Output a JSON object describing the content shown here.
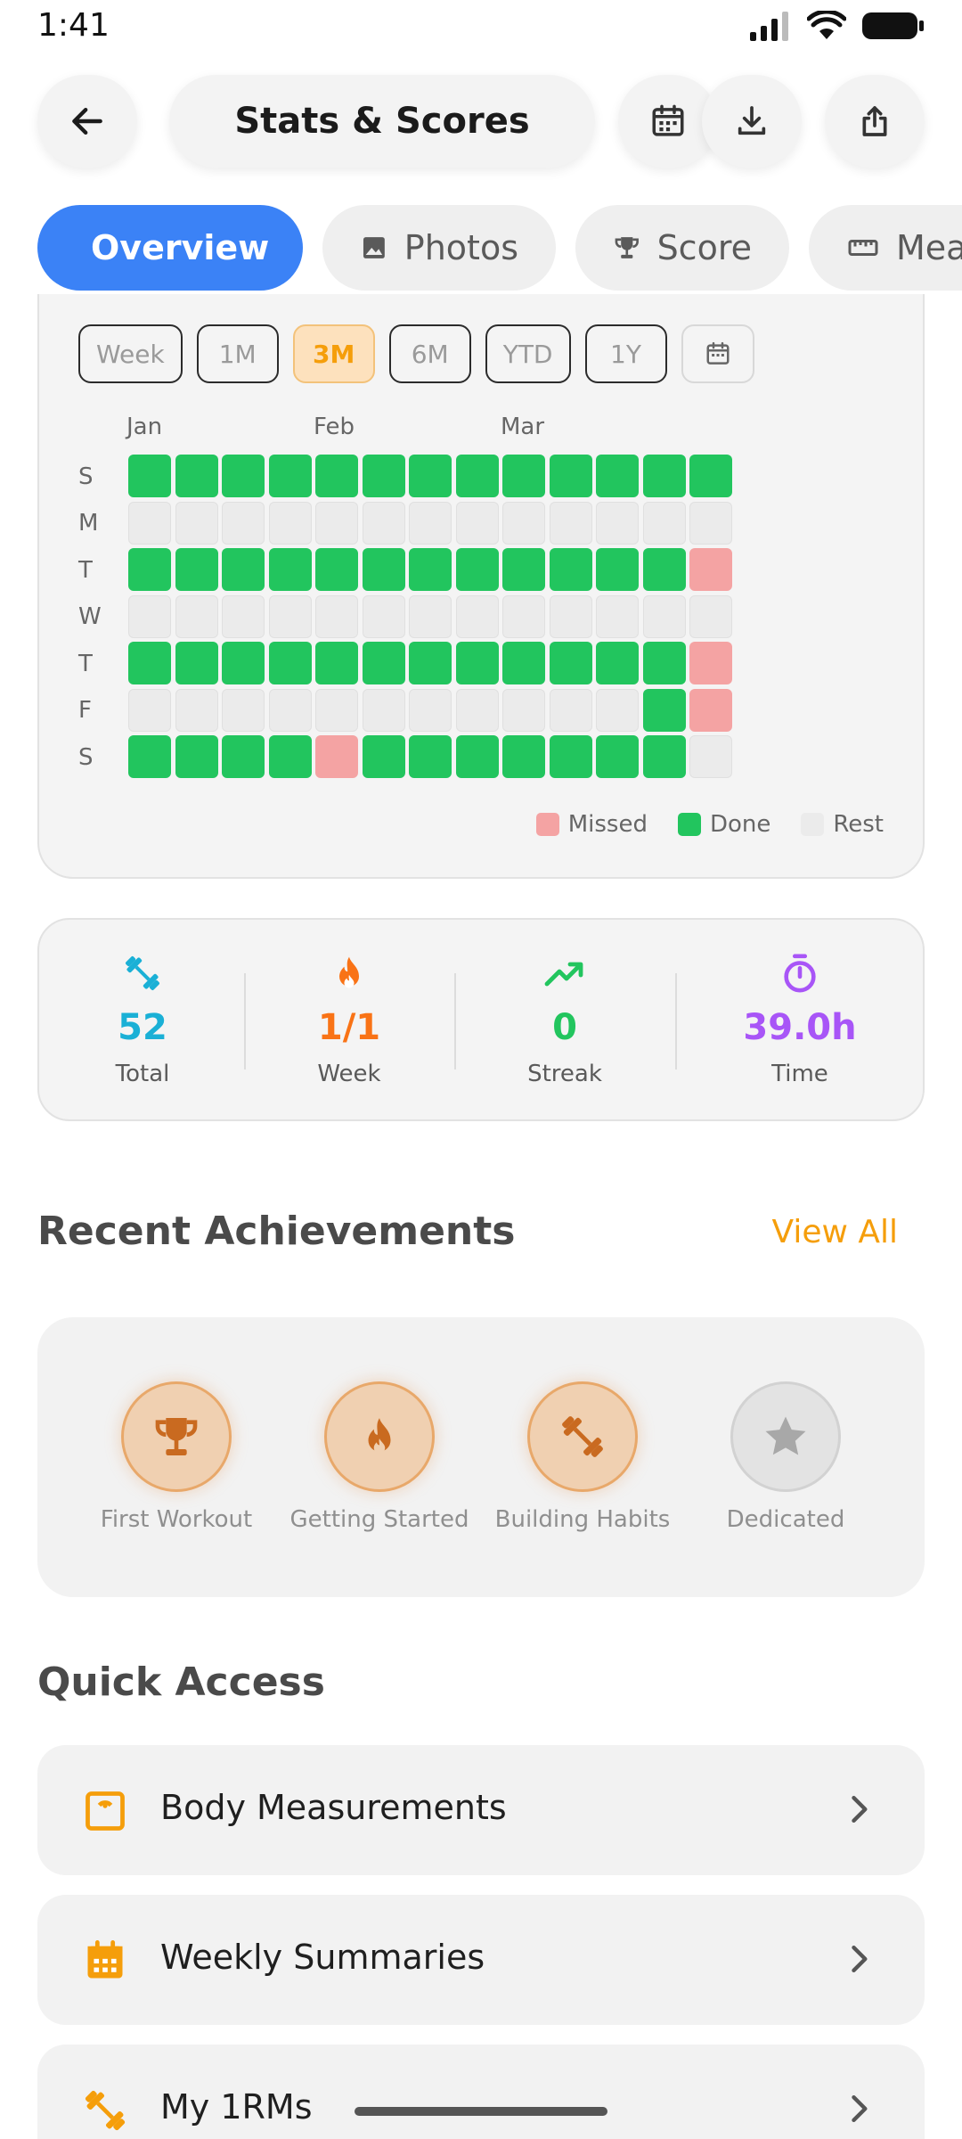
{
  "status_bar": {
    "time": "1:41"
  },
  "header": {
    "title": "Stats & Scores"
  },
  "tabs": [
    {
      "label": "Overview",
      "icon": "dashboard-icon",
      "active": true
    },
    {
      "label": "Photos",
      "icon": "image-icon",
      "active": false
    },
    {
      "label": "Score",
      "icon": "trophy-icon",
      "active": false
    },
    {
      "label": "Mea",
      "icon": "ruler-icon",
      "active": false
    }
  ],
  "activity": {
    "ranges": [
      "Week",
      "1M",
      "3M",
      "6M",
      "YTD",
      "1Y"
    ],
    "selected_range": "3M",
    "months": [
      "Jan",
      "Feb",
      "Mar"
    ],
    "day_labels": [
      "S",
      "M",
      "T",
      "W",
      "T",
      "F",
      "S"
    ],
    "grid_rows": [
      "DDDDDDDDDDDDD",
      "RRRRRRRRRRRRR",
      "DDDDDDDDDDDDM",
      "RRRRRRRRRRRRR",
      "DDDDDDDDDDDDM",
      "RRRRRRRRRRRDM",
      "DDDDMDDDDDDDR"
    ],
    "legend": {
      "missed": "Missed",
      "done": "Done",
      "rest": "Rest"
    },
    "colors": {
      "done": "#22c55e",
      "missed": "#f4a3a3",
      "rest": "#ebebeb"
    }
  },
  "stats": [
    {
      "icon": "dumbbell-icon",
      "value": "52",
      "label": "Total",
      "color": "#1ab0d6"
    },
    {
      "icon": "fire-icon",
      "value": "1/1",
      "label": "Week",
      "color": "#f97316"
    },
    {
      "icon": "trending-up-icon",
      "value": "0",
      "label": "Streak",
      "color": "#22c55e"
    },
    {
      "icon": "timer-icon",
      "value": "39.0h",
      "label": "Time",
      "color": "#a855f7"
    }
  ],
  "achievements": {
    "title": "Recent Achievements",
    "view_all": "View All",
    "items": [
      {
        "label": "First Workout",
        "icon": "trophy-icon",
        "earned": true
      },
      {
        "label": "Getting Started",
        "icon": "fire-icon",
        "earned": true
      },
      {
        "label": "Building Habits",
        "icon": "dumbbell-icon",
        "earned": true
      },
      {
        "label": "Dedicated",
        "icon": "star-icon",
        "earned": false
      }
    ]
  },
  "quick_access": {
    "title": "Quick Access",
    "items": [
      {
        "label": "Body Measurements",
        "icon": "scale-icon"
      },
      {
        "label": "Weekly Summaries",
        "icon": "calendar-icon"
      },
      {
        "label": "My 1RMs",
        "icon": "dumbbell-icon"
      }
    ]
  },
  "accent": "#f59e0b",
  "primary": "#3b82f6"
}
